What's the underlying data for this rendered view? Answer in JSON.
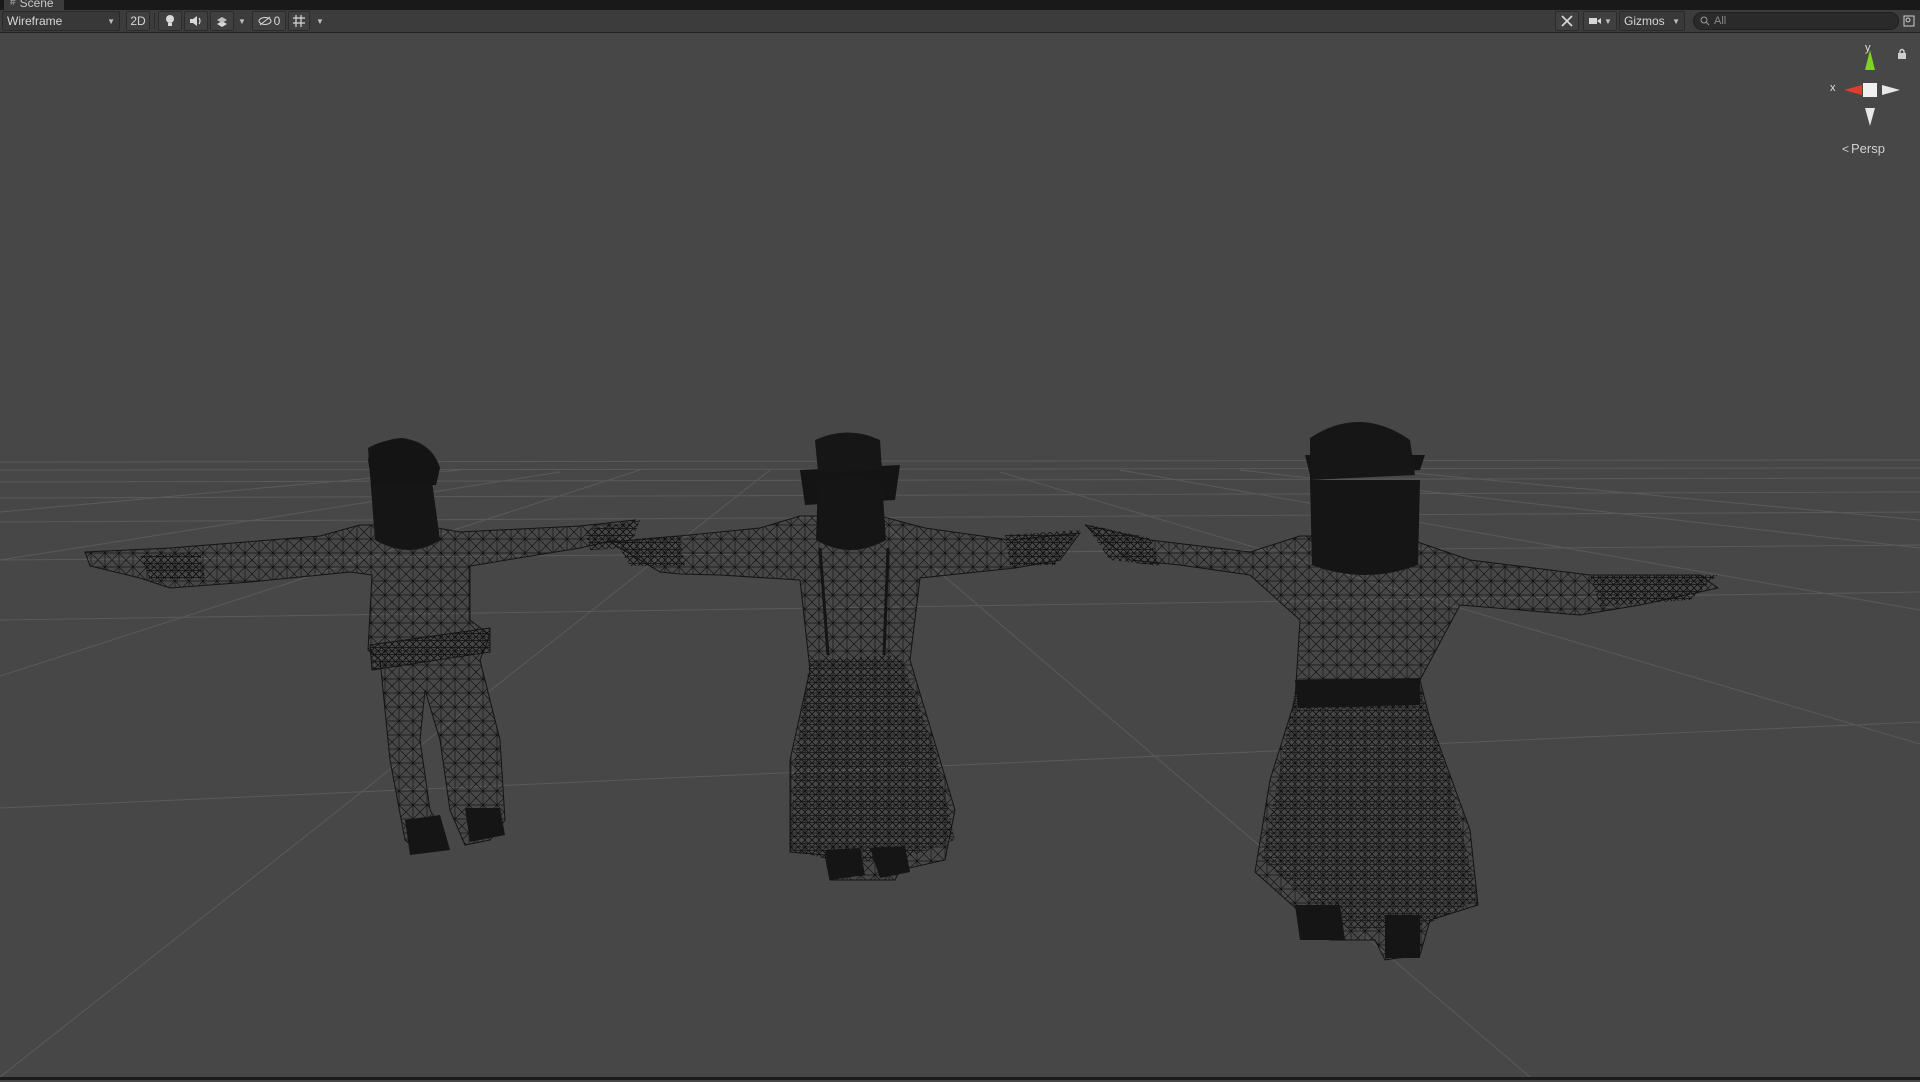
{
  "window": {
    "tab_title": "Scene",
    "tab_icon": "hash-icon"
  },
  "toolbar": {
    "draw_mode": "Wireframe",
    "btn_2d": "2D",
    "lighting_icon": "lightbulb-icon",
    "audio_icon": "speaker-icon",
    "effects_icon": "effects-icon",
    "hidden_count": "0",
    "hidden_icon": "eye-hidden-icon",
    "grid_icon": "grid-icon",
    "tools_icon": "tools-icon",
    "camera_icon": "camera-icon",
    "gizmos_label": "Gizmos",
    "search_placeholder": "All",
    "search_icon": "search-icon"
  },
  "orientation_gizmo": {
    "y_label": "y",
    "x_label": "x",
    "projection_label": "Persp",
    "colors": {
      "y": "#7ed321",
      "x": "#e33b2e",
      "neutral": "#e8e8e8"
    }
  },
  "scene": {
    "background_color": "#474747",
    "grid_color": "#5e5e5e",
    "wire_color": "#141414",
    "objects": [
      "character-left",
      "character-middle",
      "character-right"
    ]
  }
}
